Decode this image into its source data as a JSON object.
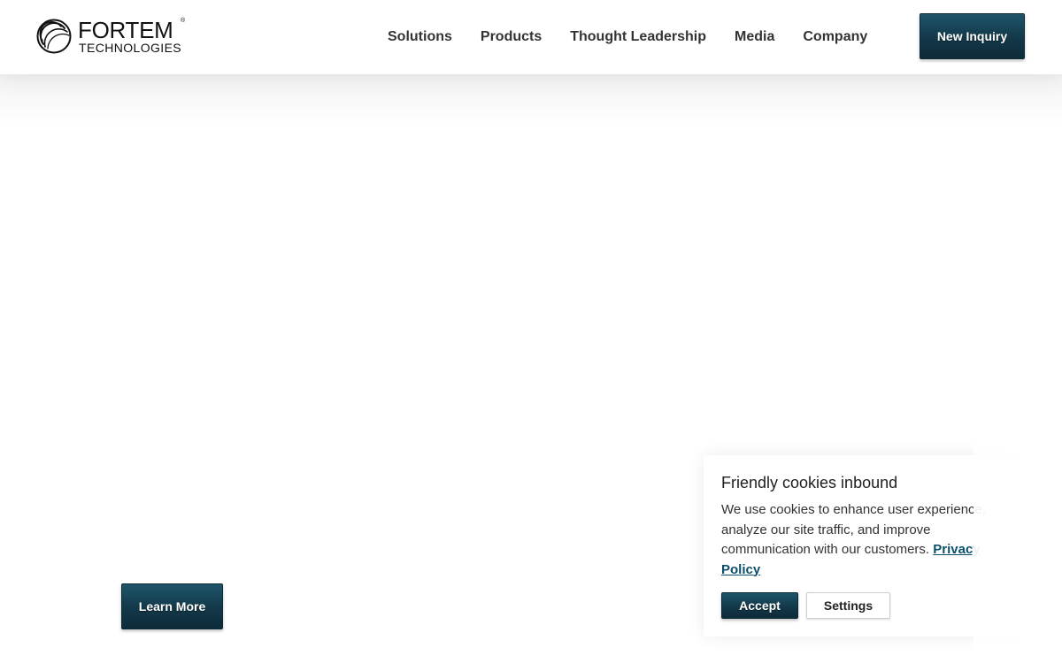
{
  "header": {
    "logo": {
      "name": "FORTEM",
      "registered": "®",
      "subtitle": "TECHNOLOGIES",
      "icon": "fortem-swirl-logo-icon"
    },
    "nav": [
      {
        "label": "Solutions"
      },
      {
        "label": "Products"
      },
      {
        "label": "Thought Leadership"
      },
      {
        "label": "Media"
      },
      {
        "label": "Company"
      }
    ],
    "cta_label": "New Inquiry"
  },
  "hero": {
    "learn_more_label": "Learn More"
  },
  "cookie_banner": {
    "title": "Friendly cookies inbound",
    "text": "We use cookies to enhance user experience, analyze our site traffic, and improve communication with our customers.",
    "link_label": "Privacy Policy",
    "accept_label": "Accept",
    "settings_label": "Settings"
  },
  "colors": {
    "brand_dark": "#133849",
    "link": "#0b4f6c",
    "nav_text": "#333333"
  }
}
